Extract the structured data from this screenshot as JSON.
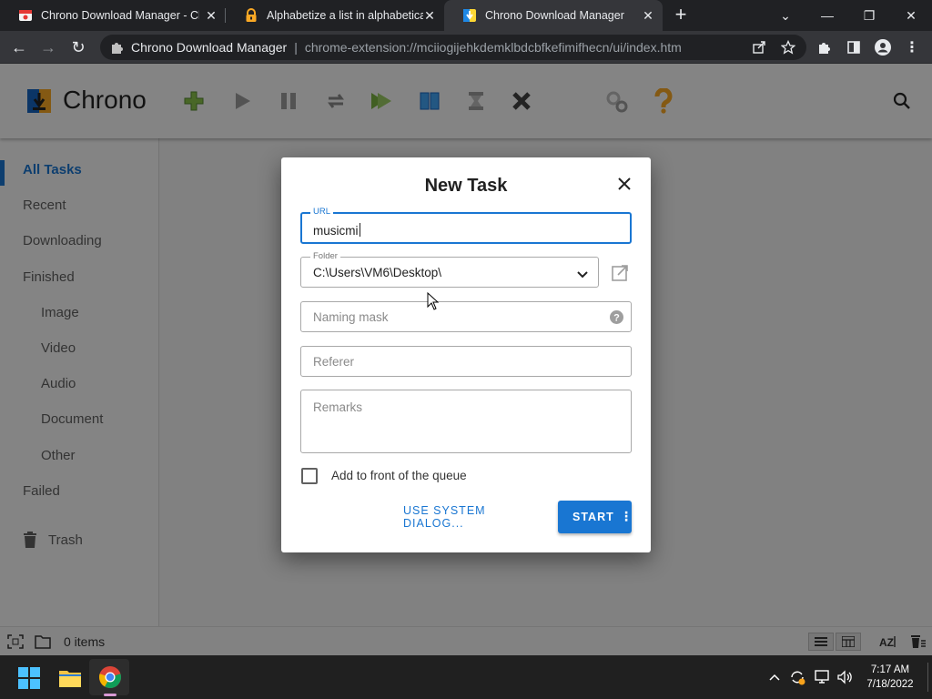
{
  "browser": {
    "tabs": [
      {
        "title": "Chrono Download Manager - Ch",
        "active": false
      },
      {
        "title": "Alphabetize a list in alphabetical",
        "active": false
      },
      {
        "title": "Chrono Download Manager",
        "active": true
      }
    ],
    "site_name": "Chrono Download Manager",
    "url": "chrome-extension://mciiogijehkdemklbdcbfkefimifhecn/ui/index.htm"
  },
  "app": {
    "brand": "Chrono",
    "toolbar_icons": [
      "add-task-icon",
      "start-icon",
      "pause-icon",
      "redownload-icon",
      "start-all-icon",
      "pause-all-icon",
      "clear-icon",
      "delete-icon",
      "settings-icon",
      "help-icon"
    ],
    "sidebar": {
      "all_tasks": "All Tasks",
      "recent": "Recent",
      "downloading": "Downloading",
      "finished": "Finished",
      "image": "Image",
      "video": "Video",
      "audio": "Audio",
      "document": "Document",
      "other": "Other",
      "failed": "Failed",
      "trash": "Trash"
    },
    "statusbar": {
      "items_count": "0 items"
    }
  },
  "dialog": {
    "title": "New Task",
    "url_label": "URL",
    "url_value": "musicmi",
    "folder_label": "Folder",
    "folder_value": "C:\\Users\\VM6\\Desktop\\",
    "naming_mask_placeholder": "Naming mask",
    "referer_placeholder": "Referer",
    "remarks_placeholder": "Remarks",
    "add_to_front_label": "Add to front of the queue",
    "add_to_front_checked": false,
    "system_dialog_button": "USE SYSTEM DIALOG...",
    "start_button": "START"
  },
  "taskbar": {
    "time": "7:17 AM",
    "date": "7/18/2022"
  },
  "colors": {
    "accent": "#1976d2",
    "browser_dark": "#202124",
    "browser_toolbar": "#35363a"
  }
}
